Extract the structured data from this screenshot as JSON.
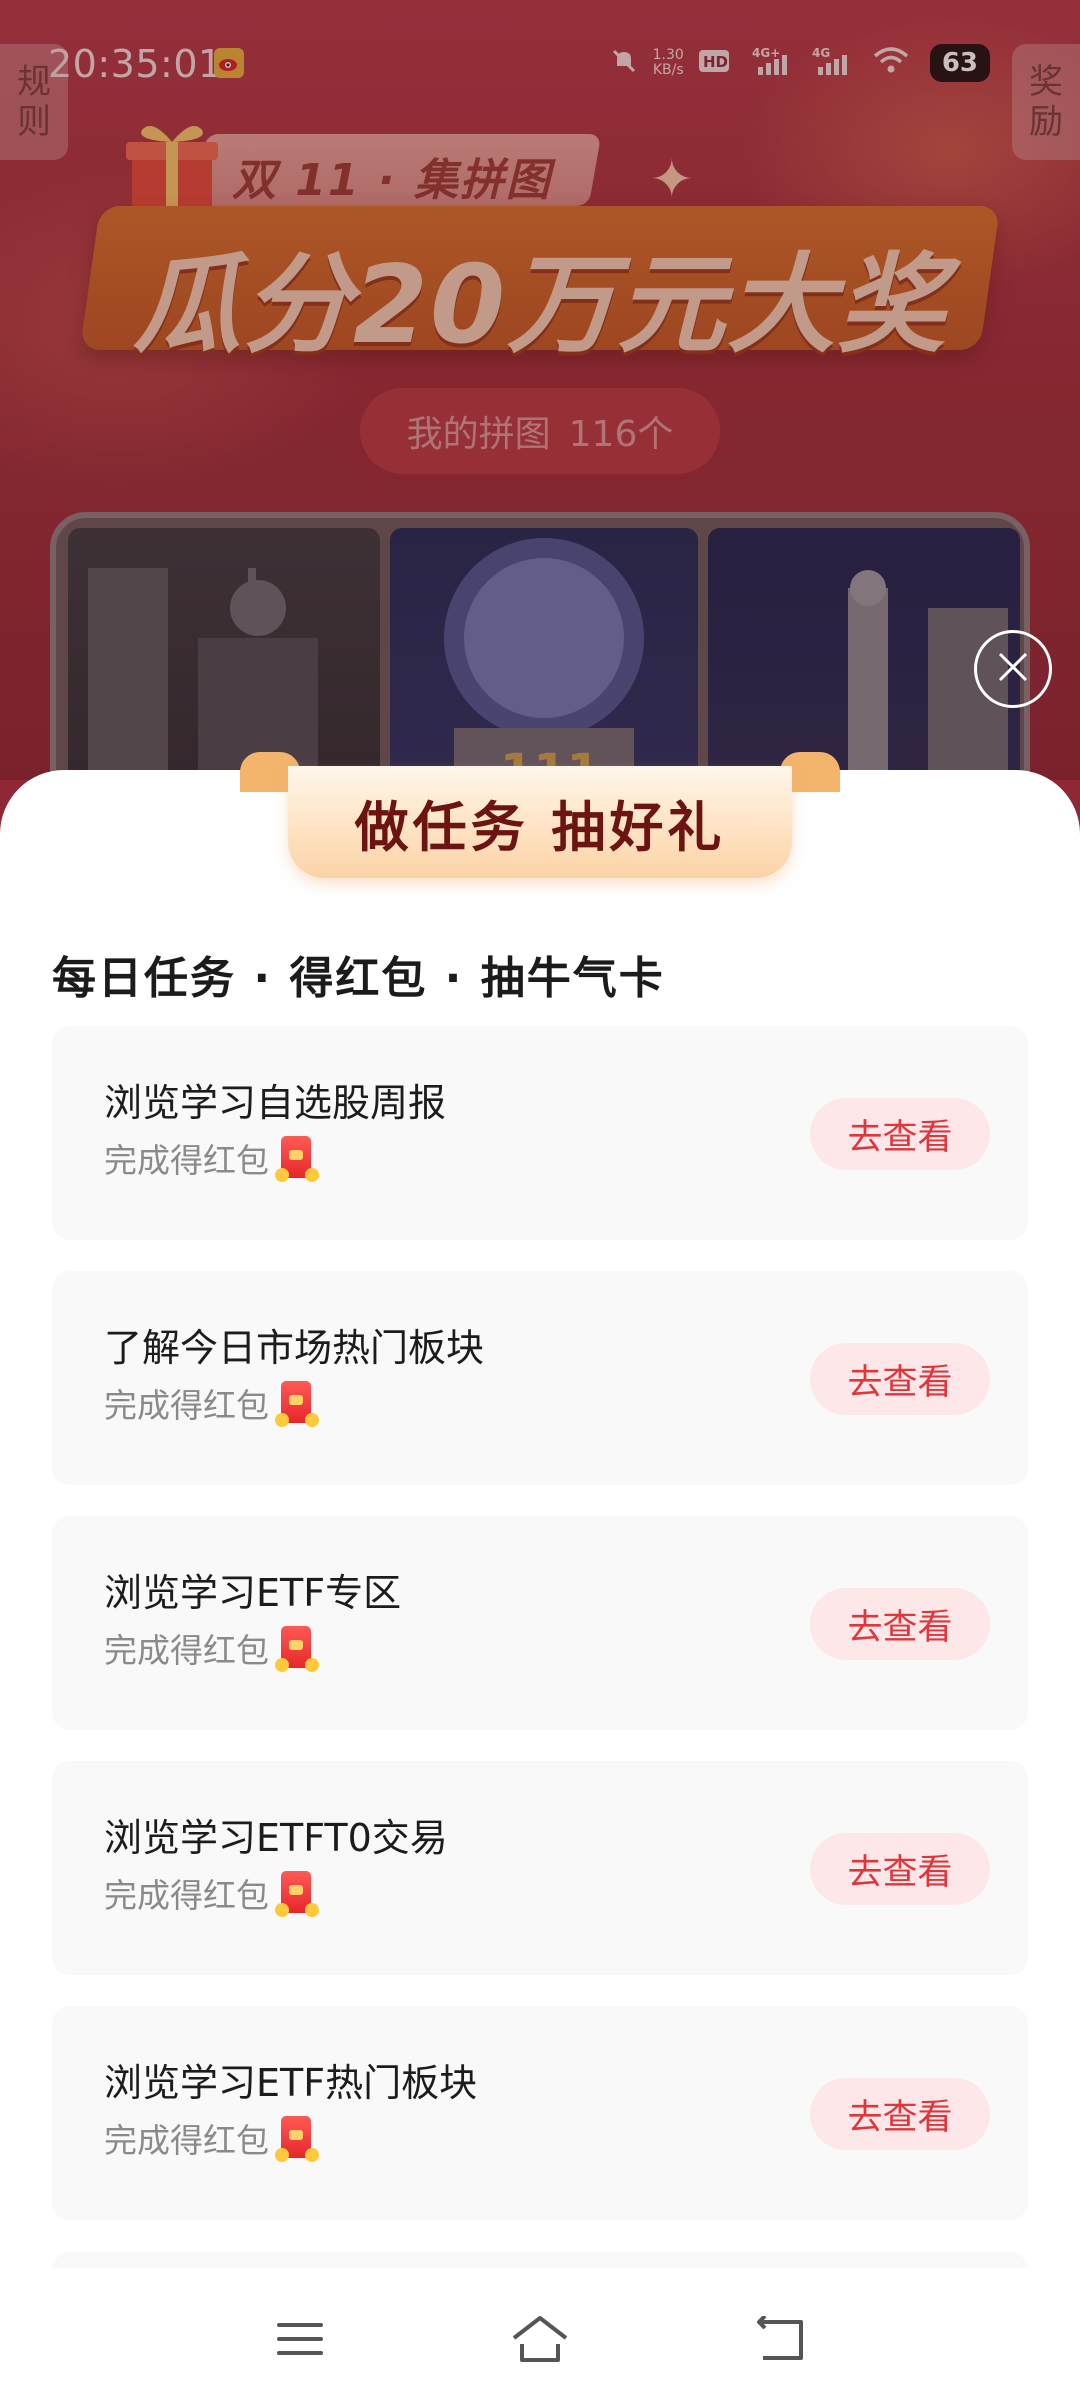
{
  "status_bar": {
    "time": "20:35:01",
    "speed_value": "1.30",
    "speed_unit": "KB/s",
    "battery": "63"
  },
  "side_tabs": {
    "rules": [
      "规",
      "则"
    ],
    "rewards": [
      "奖",
      "励"
    ]
  },
  "banner": {
    "subtitle": "双 11 · 集拼图",
    "title": "瓜分20万元大奖"
  },
  "my_puzzle": {
    "label": "我的拼图",
    "count": "116个"
  },
  "sheet": {
    "title": "做任务 抽好礼",
    "section_title": "每日任务 · 得红包 · 抽牛气卡"
  },
  "tasks": [
    {
      "name": "浏览学习自选股周报",
      "reward": "完成得红包",
      "button": "去查看"
    },
    {
      "name": "了解今日市场热门板块",
      "reward": "完成得红包",
      "button": "去查看"
    },
    {
      "name": "浏览学习ETF专区",
      "reward": "完成得红包",
      "button": "去查看"
    },
    {
      "name": "浏览学习ETFT0交易",
      "reward": "完成得红包",
      "button": "去查看"
    },
    {
      "name": "浏览学习ETF热门板块",
      "reward": "完成得红包",
      "button": "去查看"
    }
  ],
  "colors": {
    "accent_red": "#e0363b",
    "button_bg": "#fde7e8",
    "title_text": "#6b1412",
    "banner_orange": "#c05a25"
  },
  "icons": {
    "close": "close-icon",
    "reward": "red-envelope-icon",
    "nav": [
      "menu-icon",
      "home-icon",
      "back-icon"
    ]
  }
}
